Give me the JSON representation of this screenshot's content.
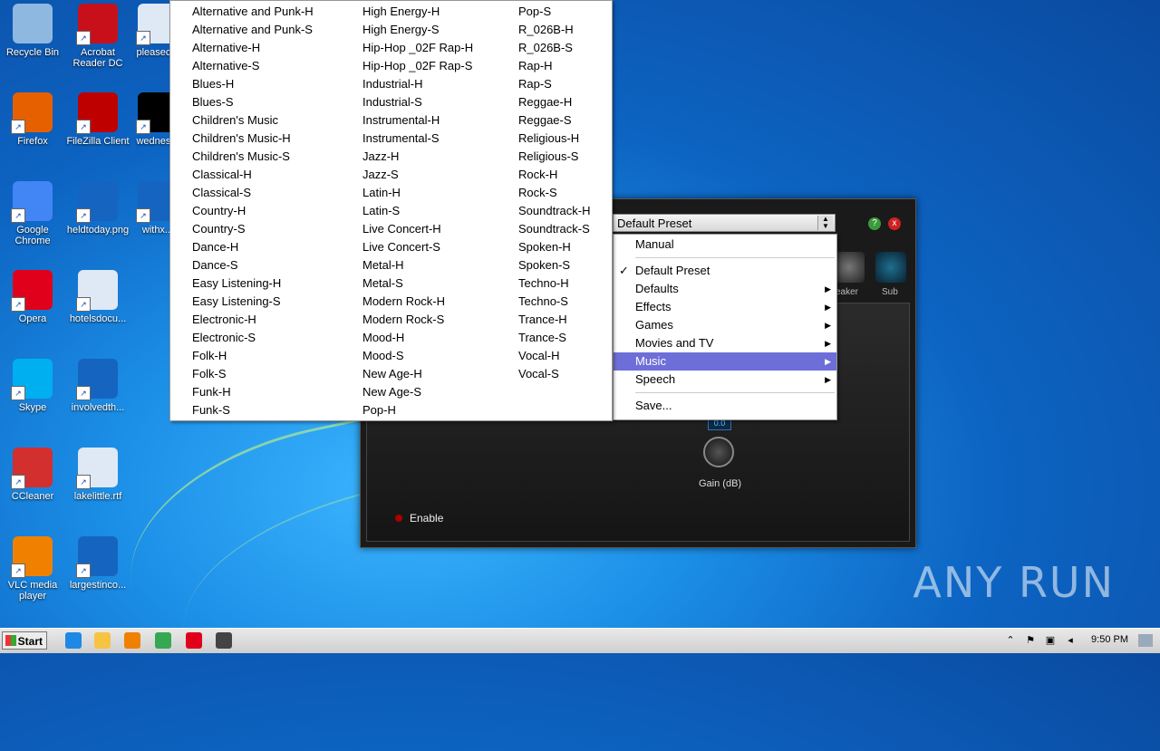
{
  "desktop_icons": [
    {
      "label": "Recycle Bin",
      "icon": "recycle-bin-icon",
      "color": "#8fb8e0"
    },
    {
      "label": "Acrobat\nReader DC",
      "icon": "acrobat-icon",
      "color": "#c8101b"
    },
    {
      "label": "pleasec...",
      "icon": "word-doc-icon",
      "color": "#dfe8f5"
    },
    {
      "label": "Firefox",
      "icon": "firefox-icon",
      "color": "#e66000"
    },
    {
      "label": "FileZilla Client",
      "icon": "filezilla-icon",
      "color": "#bf0000"
    },
    {
      "label": "wednes...",
      "icon": "black-file-icon",
      "color": "#000000"
    },
    {
      "label": "Google\nChrome",
      "icon": "chrome-icon",
      "color": "#4285f4"
    },
    {
      "label": "heldtoday.png",
      "icon": "png-file-icon",
      "color": "#1565c0"
    },
    {
      "label": "withx...",
      "icon": "file-icon",
      "color": "#1565c0"
    },
    {
      "label": "Opera",
      "icon": "opera-icon",
      "color": "#e0001b"
    },
    {
      "label": "hotelsdocu...",
      "icon": "word-doc-icon",
      "color": "#dfe8f5"
    },
    {
      "label": "Skype",
      "icon": "skype-icon",
      "color": "#00aff0"
    },
    {
      "label": "involvedth...",
      "icon": "file-icon",
      "color": "#1565c0"
    },
    {
      "label": "CCleaner",
      "icon": "ccleaner-icon",
      "color": "#d32f2f"
    },
    {
      "label": "lakelittle.rtf",
      "icon": "word-doc-icon",
      "color": "#dfe8f5"
    },
    {
      "label": "VLC media\nplayer",
      "icon": "vlc-icon",
      "color": "#f08000"
    },
    {
      "label": "largestinco...",
      "icon": "file-icon",
      "color": "#1565c0"
    }
  ],
  "app": {
    "preset_value": "Default Preset",
    "enable_label": "Enable",
    "gain_label": "Gain (dB)",
    "gain_value": "0.0",
    "speaker_label": "eaker",
    "sub_label": "Sub"
  },
  "preset_menu": {
    "items": [
      {
        "label": "Manual",
        "type": "item"
      },
      {
        "type": "sep"
      },
      {
        "label": "Default Preset",
        "type": "item",
        "checked": true
      },
      {
        "label": "Defaults",
        "type": "item",
        "submenu": true
      },
      {
        "label": "Effects",
        "type": "item",
        "submenu": true
      },
      {
        "label": "Games",
        "type": "item",
        "submenu": true
      },
      {
        "label": "Movies and TV",
        "type": "item",
        "submenu": true
      },
      {
        "label": "Music",
        "type": "item",
        "submenu": true,
        "active": true
      },
      {
        "label": "Speech",
        "type": "item",
        "submenu": true
      },
      {
        "type": "sep"
      },
      {
        "label": "Save...",
        "type": "item"
      }
    ]
  },
  "music_submenu": {
    "columns": [
      [
        "Alternative and Punk-H",
        "Alternative and Punk-S",
        "Alternative-H",
        "Alternative-S",
        "Blues-H",
        "Blues-S",
        "Children's Music",
        "Children's Music-H",
        "Children's Music-S",
        "Classical-H",
        "Classical-S",
        "Country-H",
        "Country-S",
        "Dance-H",
        "Dance-S",
        "Easy Listening-H",
        "Easy Listening-S",
        "Electronic-H",
        "Electronic-S",
        "Folk-H",
        "Folk-S",
        "Funk-H",
        "Funk-S"
      ],
      [
        "High Energy-H",
        "High Energy-S",
        "Hip-Hop _02F Rap-H",
        "Hip-Hop _02F Rap-S",
        "Industrial-H",
        "Industrial-S",
        "Instrumental-H",
        "Instrumental-S",
        "Jazz-H",
        "Jazz-S",
        "Latin-H",
        "Latin-S",
        "Live Concert-H",
        "Live Concert-S",
        "Metal-H",
        "Metal-S",
        "Modern Rock-H",
        "Modern Rock-S",
        "Mood-H",
        "Mood-S",
        "New Age-H",
        "New Age-S",
        "Pop-H"
      ],
      [
        "Pop-S",
        "R_026B-H",
        "R_026B-S",
        "Rap-H",
        "Rap-S",
        "Reggae-H",
        "Reggae-S",
        "Religious-H",
        "Religious-S",
        "Rock-H",
        "Rock-S",
        "Soundtrack-H",
        "Soundtrack-S",
        "Spoken-H",
        "Spoken-S",
        "Techno-H",
        "Techno-S",
        "Trance-H",
        "Trance-S",
        "Vocal-H",
        "Vocal-S"
      ]
    ]
  },
  "taskbar": {
    "start_label": "Start",
    "clock": "9:50 PM",
    "icons": [
      {
        "name": "ie-icon",
        "color": "#1e88e5"
      },
      {
        "name": "explorer-icon",
        "color": "#f6c343"
      },
      {
        "name": "media-player-icon",
        "color": "#f08000"
      },
      {
        "name": "chrome-icon",
        "color": "#34a853"
      },
      {
        "name": "opera-icon",
        "color": "#e0001b"
      },
      {
        "name": "audio-app-icon",
        "color": "#444444"
      }
    ]
  },
  "watermark": "ANY RUN"
}
